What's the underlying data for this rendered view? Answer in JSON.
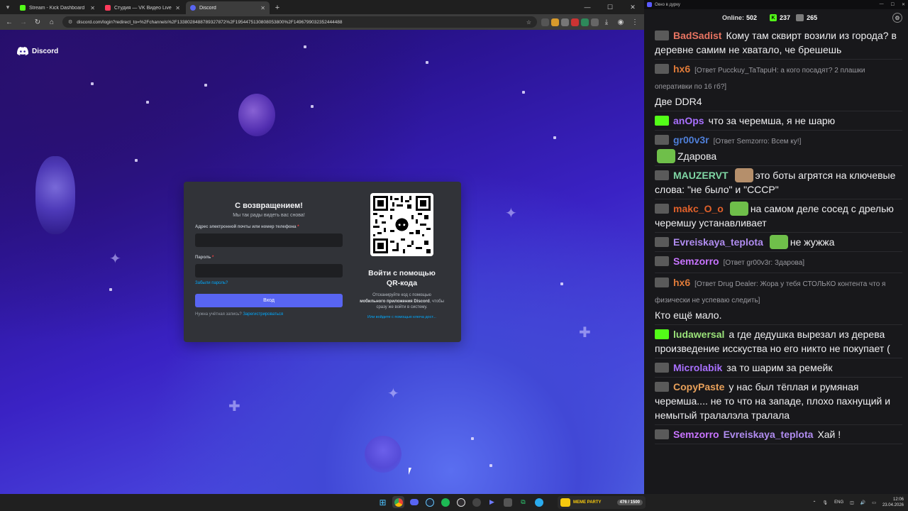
{
  "browser": {
    "tabs": [
      {
        "label": "Stream - Kick Dashboard",
        "color": "#53fc18",
        "active": false
      },
      {
        "label": "Студия — VK Видео Live",
        "color": "#ff3b5c",
        "active": false
      },
      {
        "label": "Discord",
        "color": "#5865f2",
        "active": true
      }
    ],
    "url": "discord.com/login?redirect_to=%2Fchannels%2F1338028488789327872%2F1954475130808053800%2F1496799032352444488"
  },
  "discord": {
    "brand": "Discord",
    "title": "С возвращением!",
    "subtitle": "Мы так рады видеть вас снова!",
    "email_label": "Адрес электронной почты или номер телефона",
    "required_mark": "*",
    "password_label": "Пароль",
    "forgot": "Забыли пароль?",
    "login_btn": "Вход",
    "need_account": "Нужна учётная запись?",
    "register": "Зарегистрироваться",
    "qr_title_1": "Войти с помощью",
    "qr_title_2": "QR-кода",
    "qr_desc_1": "Отсканируйте код с помощью",
    "qr_desc_bold": "мобильного приложения Discord",
    "qr_desc_2": ", чтобы сразу же войти в систему.",
    "passkey": "Или войдите с помощью ключа дост..."
  },
  "chat": {
    "window_title": "Окно в дурку",
    "online_label": "Online:",
    "online_value": "502",
    "kick_count": "237",
    "twitch_count": "265",
    "messages": [
      {
        "user": "BadSadist",
        "color": "#e87462",
        "reply": "",
        "text": "Кому там сквирт возили из города? в деревне самим не хватало, че брешешь"
      },
      {
        "user": "hx6",
        "color": "#e07b39",
        "reply": "[Ответ Pucckuy_TaTapuH: а кого посадят? 2 плашки оперативки по 16 гб?]",
        "text": "Две DDR4"
      },
      {
        "user": "anOps",
        "color": "#a970ff",
        "reply": "",
        "text": "что за черемша, я не шарю"
      },
      {
        "user": "gr00v3r",
        "color": "#4f7fd8",
        "reply": "[Ответ Semzorro: Всем ку!]",
        "text": "Zдарова"
      },
      {
        "user": "MAUZERVT",
        "color": "#7fd6a4",
        "reply": "",
        "text": "это боты агрятся на ключевые слова: \"не было\" и \"СССР\""
      },
      {
        "user": "makc_O_o",
        "color": "#e0602a",
        "reply": "",
        "text": "на самом деле сосед с дрелью черемшу устанавливает"
      },
      {
        "user": "Evreiskaya_teplota",
        "color": "#b08cf0",
        "reply": "",
        "text": "не жужжа"
      },
      {
        "user": "Semzorro",
        "color": "#c874ff",
        "reply": "[Ответ gr00v3r: Здарова]",
        "text": ""
      },
      {
        "user": "hx6",
        "color": "#e07b39",
        "reply": "[Ответ Drug Dealer: Жора у тебя СТОЛЬКО контента что я физически не успеваю следить]",
        "text": "Кто ещё мало."
      },
      {
        "user": "ludawersal",
        "color": "#9be37a",
        "reply": "",
        "text": "а где дедушка вырезал из дерева произведение исскуства но его никто не покупает ("
      },
      {
        "user": "Microlabik",
        "color": "#a970ff",
        "reply": "",
        "text": "за то шарим за ремейк"
      },
      {
        "user": "CopyPaste",
        "color": "#e8a05a",
        "reply": "",
        "text": "у нас был тёплая и румяная черемша.... не то что на западе, плохо пахнущий и немытый тралалэла тралала"
      },
      {
        "user": "Semzorro",
        "color": "#c874ff",
        "reply": "",
        "mention": "Evreiskaya_teplota",
        "text": "Хай !"
      }
    ]
  },
  "taskbar": {
    "meme_label": "MEME PARTY",
    "meme_count": "476 / 1500",
    "lang": "ENG",
    "time": "12:06",
    "date": "23.04.2026"
  }
}
